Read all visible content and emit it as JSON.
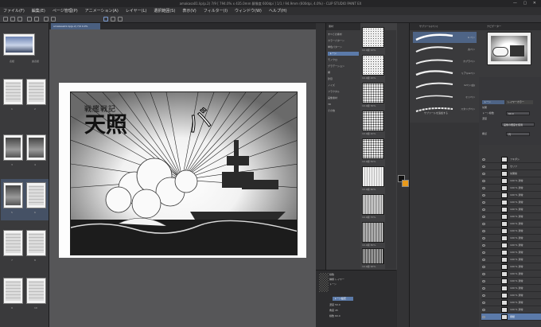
{
  "window": {
    "title": "amakasa01.lip(p.2) 7/9 [ 794.0% x 435.0mm 解像度 600dpi ] 1/1 / 94.9mm (600dpi, 4.0%) - CLIP STUDIO PAINT EX"
  },
  "menu": [
    "ファイル(F)",
    "編集(E)",
    "ページ管理(P)",
    "アニメーション(A)",
    "レイヤー(L)",
    "選択範囲(S)",
    "表示(V)",
    "フィルター(I)",
    "ウィンドウ(W)",
    "ヘルプ(H)"
  ],
  "doc_tab": "amakasa01.lip(p.2) 7/9 4.0%",
  "pages": [
    {
      "label": "表紙",
      "num": "1"
    },
    {
      "label": "裏表紙",
      "num": "2"
    },
    {
      "label": "1",
      "num": "3"
    },
    {
      "label": "2",
      "num": "4"
    },
    {
      "label": "3",
      "num": "5"
    },
    {
      "label": "4",
      "num": "6"
    },
    {
      "label": "5",
      "num": "7"
    },
    {
      "label": "6",
      "num": "8"
    },
    {
      "label": "7",
      "num": "9"
    },
    {
      "label": "8",
      "num": "10"
    },
    {
      "label": "9",
      "num": "11"
    },
    {
      "label": "10",
      "num": "12"
    }
  ],
  "manga": {
    "subtitle": "戦艦戦記",
    "title": "天照",
    "sfx": "バ"
  },
  "material_tree": {
    "header": "素材",
    "items": [
      "すべての素材",
      "カラーパターン",
      "単色パターン",
      "トーン",
      "モノクロ",
      "グラデーション",
      "網",
      "砂目",
      "ノイズ",
      "フラクタル",
      "画像素材",
      "3D",
      "その他"
    ]
  },
  "tones": [
    {
      "label": "10.0線 10%"
    },
    {
      "label": "10.0線 20%"
    },
    {
      "label": "10.0線 30%"
    },
    {
      "label": "10.0線 40%"
    },
    {
      "label": "10.0線 50%"
    },
    {
      "label": "10.0線 60%"
    },
    {
      "label": "10.0線 70%"
    },
    {
      "label": "10.0線 80%"
    },
    {
      "label": "10.0線 90%"
    }
  ],
  "properties": {
    "lines": [
      "線数",
      "種類  レイヤー",
      "トーン",
      "濃度  50.0",
      "角度  45",
      "線数  60.0"
    ],
    "tone_button": "トーン設定"
  },
  "brush": {
    "header": "サブツール[ペン]",
    "items": [
      "G ペン",
      "丸ペン",
      "カブラペン",
      "リアルGペン",
      "Gペン(古)",
      "ミリペン",
      "スタンプペン"
    ],
    "add_button": "サブツールを追加する"
  },
  "navigator": {
    "header": "ナビゲーター"
  },
  "layer_property": {
    "tabs": [
      "トーン",
      "レイヤーカラー"
    ],
    "fields": [
      {
        "label": "効果",
        "value": ""
      },
      {
        "label": "トーン線数",
        "value": "60.0"
      },
      {
        "label": "濃度",
        "value": "画像の輝度を使用"
      },
      {
        "label": "網点",
        "value": "円"
      }
    ]
  },
  "layers": {
    "items": [
      "フキダシ",
      "セリフ",
      "効果線",
      "100 % 通常",
      "100 % 通常",
      "100 % 通常",
      "100 % 通常",
      "100 % 通常",
      "100 % 通常",
      "100 % 通常",
      "100 % 通常",
      "100 % 通常",
      "100 % 通常",
      "100 % 通常",
      "100 % 通常",
      "100 % 通常",
      "100 % 通常",
      "100 % 通常",
      "100 % 通常",
      "100 % 通常",
      "100 % 通常",
      "100 % 通常",
      "用紙"
    ],
    "selected_index": 22
  }
}
